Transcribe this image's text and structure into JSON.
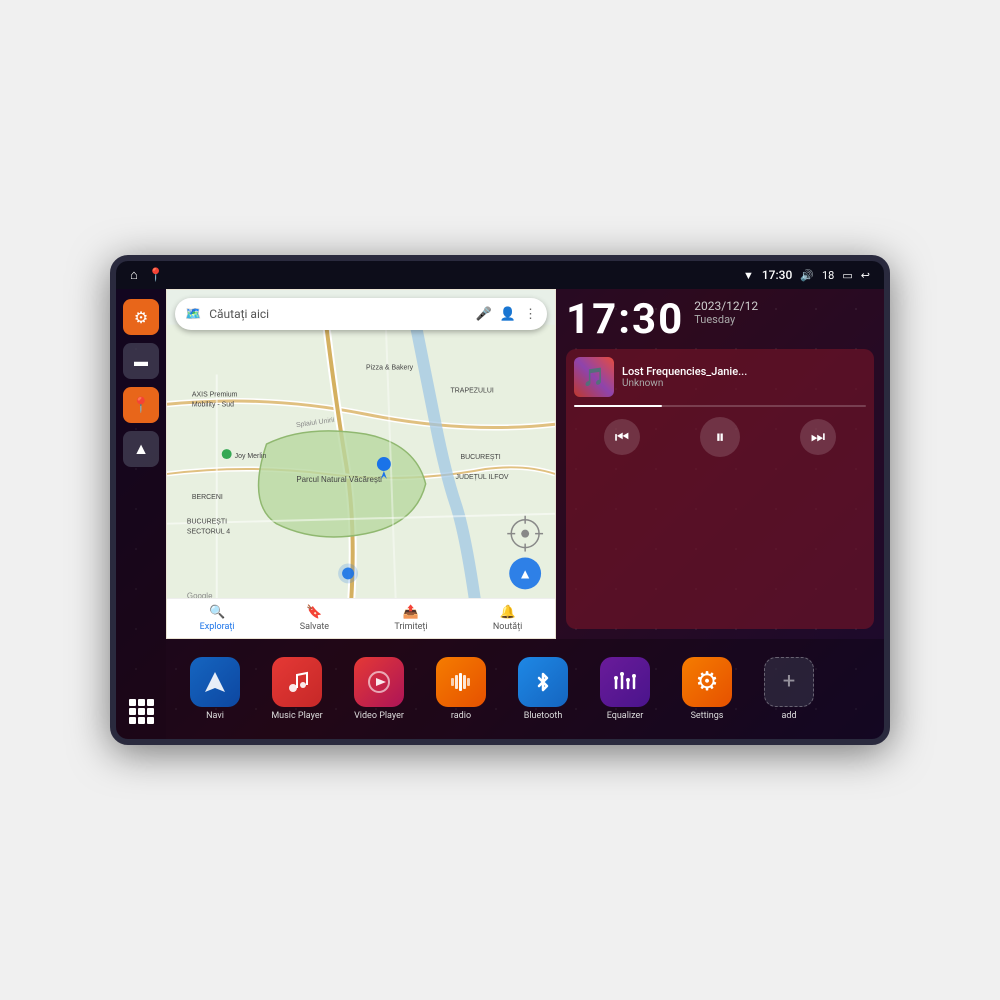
{
  "device": {
    "status_bar": {
      "wifi_icon": "▼",
      "time": "17:30",
      "volume_icon": "🔊",
      "battery_level": "18",
      "battery_icon": "🔋",
      "back_icon": "↩"
    },
    "sidebar": {
      "settings_label": "settings",
      "files_label": "files",
      "maps_label": "maps",
      "nav_label": "nav",
      "grid_label": "apps"
    },
    "map": {
      "search_placeholder": "Căutați aici",
      "tabs": [
        {
          "label": "Explorați",
          "icon": "🔍",
          "active": true
        },
        {
          "label": "Salvate",
          "icon": "🔖",
          "active": false
        },
        {
          "label": "Trimiteți",
          "icon": "📤",
          "active": false
        },
        {
          "label": "Noutăți",
          "icon": "🔔",
          "active": false
        }
      ]
    },
    "clock": {
      "time": "17:30",
      "date": "2023/12/12",
      "day": "Tuesday"
    },
    "music_player": {
      "title": "Lost Frequencies_Janie...",
      "artist": "Unknown",
      "prev_label": "prev",
      "play_label": "pause",
      "next_label": "next"
    },
    "apps": [
      {
        "id": "navi",
        "label": "Navi",
        "icon_class": "icon-navi",
        "icon": "▲"
      },
      {
        "id": "music-player",
        "label": "Music Player",
        "icon_class": "icon-music",
        "icon": "♪"
      },
      {
        "id": "video-player",
        "label": "Video Player",
        "icon_class": "icon-video",
        "icon": "▶"
      },
      {
        "id": "radio",
        "label": "radio",
        "icon_class": "icon-radio",
        "icon": "📻"
      },
      {
        "id": "bluetooth",
        "label": "Bluetooth",
        "icon_class": "icon-bt",
        "icon": "✦"
      },
      {
        "id": "equalizer",
        "label": "Equalizer",
        "icon_class": "icon-eq",
        "icon": "≡"
      },
      {
        "id": "settings",
        "label": "Settings",
        "icon_class": "icon-settings",
        "icon": "⚙"
      },
      {
        "id": "add",
        "label": "add",
        "icon_class": "icon-add",
        "icon": "+"
      }
    ]
  }
}
